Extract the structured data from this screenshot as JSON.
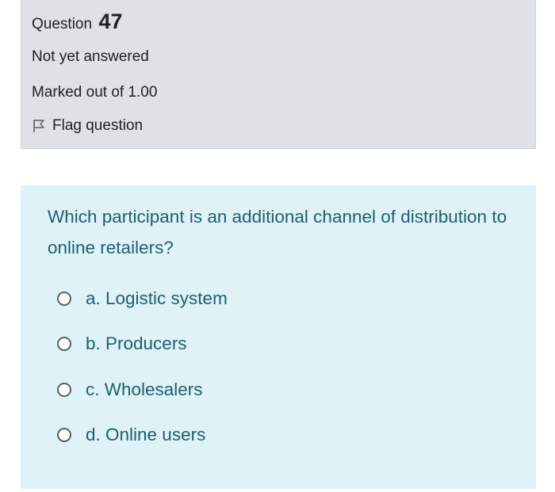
{
  "info": {
    "question_word": "Question",
    "question_number": "47",
    "state": "Not yet answered",
    "grade": "Marked out of 1.00",
    "flag_label": "Flag question"
  },
  "question": {
    "text": "Which participant is an additional channel of distribution to online retailers?"
  },
  "answers": [
    {
      "label": "a. Logistic system"
    },
    {
      "label": "b. Producers"
    },
    {
      "label": "c. Wholesalers"
    },
    {
      "label": "d. Online users"
    }
  ],
  "icons": {
    "flag": "flag-icon",
    "radio": "radio-button"
  }
}
